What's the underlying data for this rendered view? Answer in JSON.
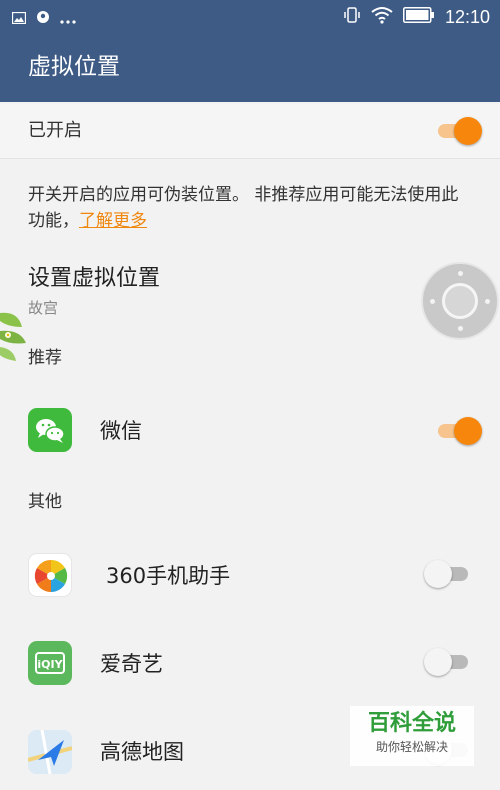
{
  "status_bar": {
    "time": "12:10",
    "left_icons": [
      "image-icon",
      "location-icon",
      "more-dots-icon"
    ],
    "right_icons": [
      "vibrate-icon",
      "wifi-icon",
      "battery-icon"
    ]
  },
  "app_bar": {
    "title": "虚拟位置"
  },
  "master_switch": {
    "label": "已开启",
    "on": true
  },
  "description": {
    "text": "开关开启的应用可伪装位置。 非推荐应用可能无法使用此功能，",
    "link_text": "了解更多"
  },
  "virtual_location": {
    "title": "设置虚拟位置",
    "value": "故宫"
  },
  "sections": {
    "recommended": "推荐",
    "others": "其他"
  },
  "recommended_apps": [
    {
      "name": "微信",
      "icon": "wechat-icon",
      "enabled": true
    }
  ],
  "other_apps": [
    {
      "name": "360手机助手",
      "icon": "360-assistant-icon",
      "enabled": false
    },
    {
      "name": "爱奇艺",
      "icon": "iqiyi-icon",
      "enabled": false
    },
    {
      "name": "高德地图",
      "icon": "amap-icon",
      "enabled": false
    }
  ],
  "watermark": {
    "main": "百科全说",
    "sub": "助你轻松解决"
  },
  "colors": {
    "header": "#3e5b86",
    "accent": "#f7870c",
    "link": "#f0870f"
  }
}
